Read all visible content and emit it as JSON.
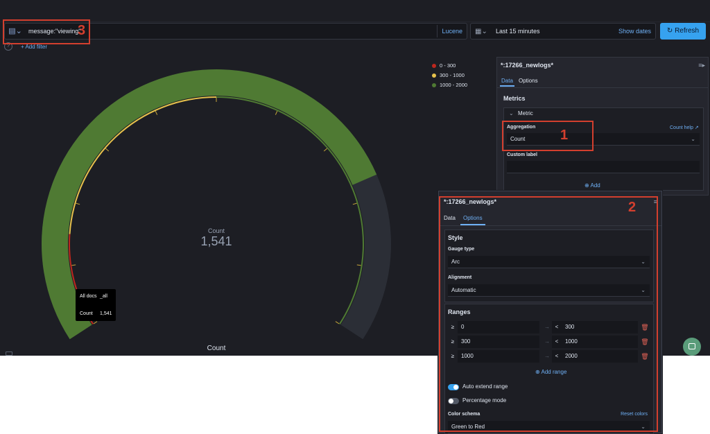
{
  "query": {
    "save_icon": "saved-query-icon",
    "text": "message:\"viewing\"",
    "language": "Lucene"
  },
  "time": {
    "calendar_icon": "calendar-icon",
    "range": "Last 15 minutes",
    "show_dates": "Show dates"
  },
  "refresh_button": "Refresh",
  "filters": {
    "add_filter": "+ Add filter"
  },
  "gauge": {
    "label": "Count",
    "value": "1,541",
    "chart_title": "Count",
    "tooltip": {
      "row1_key": "All docs",
      "row1_value": "_all",
      "row2_key": "Count",
      "row2_value": "1,541"
    },
    "legend": [
      "0 - 300",
      "300 - 1000",
      "1000 - 2000"
    ],
    "colors": {
      "low": "#bd271e",
      "mid": "#e7c24c",
      "high": "#4f7a33",
      "empty": "#2b2e36"
    }
  },
  "chart_data": {
    "type": "gauge",
    "metric": "Count",
    "value": 1541,
    "ranges": [
      {
        "from": 0,
        "to": 300,
        "color": "#bd271e"
      },
      {
        "from": 300,
        "to": 1000,
        "color": "#e7c24c"
      },
      {
        "from": 1000,
        "to": 2000,
        "color": "#4f7a33"
      }
    ],
    "min": 0,
    "max": 2000,
    "title": "Count"
  },
  "panel1": {
    "title": "*:17266_newlogs*",
    "tabs": [
      "Data",
      "Options"
    ],
    "metrics_heading": "Metrics",
    "metric_title": "Metric",
    "aggregation_label": "Aggregation",
    "count_help": "Count help",
    "aggregation_value": "Count",
    "custom_label": "Custom label",
    "add": "Add"
  },
  "panel2": {
    "title": "*:17266_newlogs*",
    "tabs": [
      "Data",
      "Options"
    ],
    "style_heading": "Style",
    "gauge_type_label": "Gauge type",
    "gauge_type_value": "Arc",
    "alignment_label": "Alignment",
    "alignment_value": "Automatic",
    "ranges_heading": "Ranges",
    "ranges": [
      {
        "ge": "≥",
        "from": "0",
        "lt": "<",
        "to": "300"
      },
      {
        "ge": "≥",
        "from": "300",
        "lt": "<",
        "to": "1000"
      },
      {
        "ge": "≥",
        "from": "1000",
        "lt": "<",
        "to": "2000"
      }
    ],
    "add_range": "Add range",
    "auto_extend": "Auto extend range",
    "percentage_mode": "Percentage mode",
    "color_schema_label": "Color schema",
    "reset_colors": "Reset colors",
    "color_schema_value": "Green to Red"
  },
  "annotations": [
    "1",
    "2",
    "3"
  ],
  "accent_color": "#36a2ef",
  "annotation_color": "#d33f2e"
}
